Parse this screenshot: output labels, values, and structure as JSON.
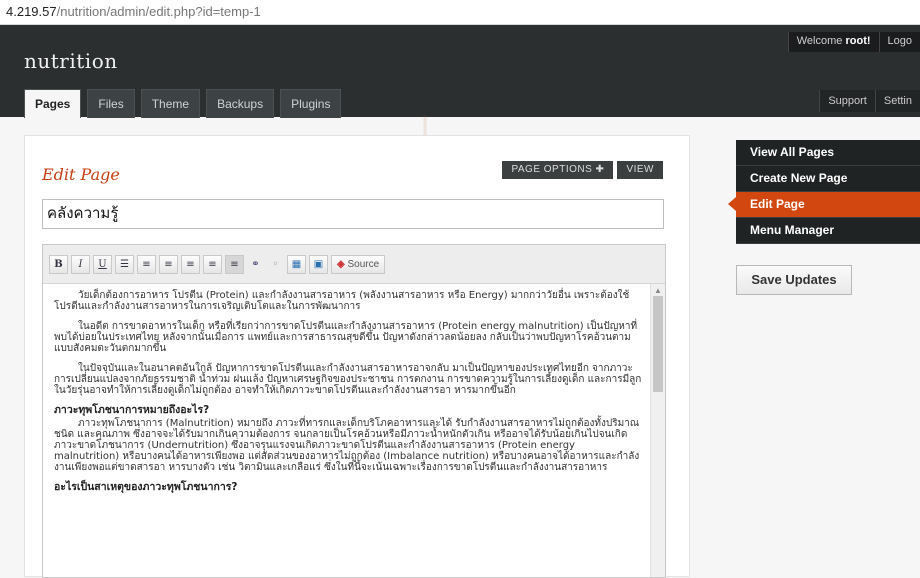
{
  "browser": {
    "url_host": "4.219.57",
    "url_path": "/nutrition/admin/edit.php?id=temp-1"
  },
  "header": {
    "site_name": "nutrition",
    "welcome_prefix": "Welcome",
    "username": "root!",
    "logout_label": "Logo",
    "support_label": "Support",
    "settings_label": "Settin",
    "tabs": [
      {
        "label": "Pages",
        "active": true
      },
      {
        "label": "Files"
      },
      {
        "label": "Theme"
      },
      {
        "label": "Backups"
      },
      {
        "label": "Plugins"
      }
    ]
  },
  "main": {
    "heading": "Edit Page",
    "page_options_label": "PAGE OPTIONS ✚",
    "view_label": "VIEW",
    "title_value": "คลังความรู้",
    "toolbar": {
      "bold": "B",
      "italic": "I",
      "underline": "U",
      "source_label": "Source"
    },
    "content": {
      "p1": "วัยเด็กต้องการอาหาร โปรตีน (Protein) และกำลังงานสารอาหาร (พลังงานสารอาหาร หรือ Energy) มากกว่าวัยอื่น เพราะต้องใช้โปรตีนและกำลังงานสารอาหารในการเจริญเติบโตและในการพัฒนาการ",
      "p2": "ในอดีต การขาดอาหารในเด็ก หรือที่เรียกว่าการขาดโปรตีนและกำลังงานสารอาหาร (Protein energy malnutrition) เป็นปัญหาที่พบได้บ่อยในประเทศไทย หลังจากนั้นเมื่อการ แพทย์และการสาธารณสุขดีขึ้น ปัญหาดังกล่าวลดน้อยลง กลับเป็นว่าพบปัญหาโรคอ้วนตามแบบสังคมตะวันตกมากขึ้น",
      "p3": "ในปัจจุบันและในอนาคตอันใกล้ ปัญหาการขาดโปรตีนและกำลังงานสารอาหารอาจกลับ มาเป็นปัญหาของประเทศไทยอีก จากภาวะการเปลี่ยนแปลงจากภัยธรรมชาติ น้ำท่วม ฝนแล้ง ปัญหาเศรษฐกิจของประชาชน การตกงาน การขาดความรู้ในการเลี้ยงดูเด็ก และการมีลูกในวัยรุ่นอาจทำให้การเลี้ยงดูเด็กไม่ถูกต้อง อาจทำให้เกิดภาวะขาดโปรตีนและกำลังงานสารอา หารมากขึ้นอีก",
      "h1": "ภาวะทุพโภชนาการหมายถึงอะไร?",
      "p4": "ภาวะทุพโภชนาการ (Malnutrition) หมายถึง ภาวะที่ทารกและเด็กบริโภคอาหารและได้ รับกำลังงานสารอาหารไม่ถูกต้องทั้งปริมาณ ชนิด และคุณภาพ ซึ่งอาจจะได้รับมากเกินความต้องการ จนกลายเป็นโรคอ้วนหรือมีภาวะน้ำหนักตัวเกิน หรืออาจได้รับน้อยเกินไปจนเกิดภาวะขาดโภชนาการ (Undernutrition) ซึ่งอาจรุนแรงจนเกิดภาวะขาดโปรตีนและกำลังงานสารอาหาร (Protein energy malnutrition) หรือบางคนได้อาหารเพียงพอ แต่สัดส่วนของอาหารไม่ถูกต้อง (Imbalance nutrition) หรือบางคนอาจได้อาหารและกำลังงานเพียงพอแต่ขาดสารอา หารบางตัว เช่น วิตามินและเกลือแร่ ซึ่งในที่นี้จะเน้นเฉพาะเรื่องการขาดโปรตีนและกำลังงานสารอาหาร",
      "h2": "อะไรเป็นสาเหตุของภาวะทุพโภชนาการ?"
    }
  },
  "sidebar": {
    "items": [
      {
        "label": "View All Pages"
      },
      {
        "label": "Create New Page"
      },
      {
        "label": "Edit Page",
        "current": true
      },
      {
        "label": "Menu Manager"
      }
    ],
    "save_label": "Save Updates"
  },
  "colors": {
    "accent": "#d2470f",
    "header_bg": "#2b2f30",
    "heading": "#c73f12"
  }
}
